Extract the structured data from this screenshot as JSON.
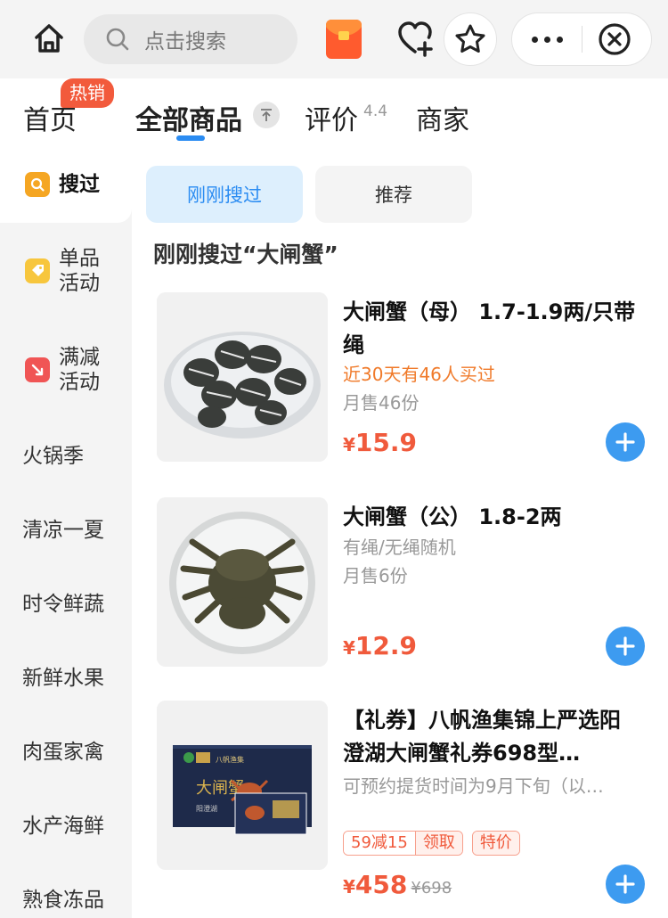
{
  "search": {
    "placeholder": "点击搜索"
  },
  "tabs": {
    "home": "首页",
    "hot_badge": "热销",
    "all": "全部商品",
    "review": "评价",
    "rating": "4.4",
    "shop": "商家"
  },
  "sidebar": {
    "items": [
      {
        "label": "搜过",
        "icon": "search-icon",
        "color": "#f5a623"
      },
      {
        "label": "单品活动",
        "line1": "单品",
        "line2": "活动",
        "icon": "tag-icon",
        "color": "#f7c63d"
      },
      {
        "label": "满减活动",
        "line1": "满减",
        "line2": "活动",
        "icon": "discount-icon",
        "color": "#f05555"
      },
      {
        "label": "火锅季"
      },
      {
        "label": "清凉一夏"
      },
      {
        "label": "时令鲜蔬"
      },
      {
        "label": "新鲜水果"
      },
      {
        "label": "肉蛋家禽"
      },
      {
        "label": "水产海鲜"
      },
      {
        "label": "熟食冻品"
      }
    ]
  },
  "segments": {
    "recent": "刚刚搜过",
    "recommend": "推荐"
  },
  "section_title": "刚刚搜过“大闸蟹”",
  "products": [
    {
      "name": "大闸蟹（母） 1.7-1.9两/只带绳",
      "highlight": "近30天有46人买过",
      "sales": "月售46份",
      "currency": "¥",
      "price": "15.9"
    },
    {
      "name": "大闸蟹（公） 1.8-2两",
      "desc": "有绳/无绳随机",
      "sales": "月售6份",
      "currency": "¥",
      "price": "12.9"
    },
    {
      "name": "【礼券】八帆渔集锦上严选阳澄湖大闸蟹礼券698型…",
      "desc": "可预约提货时间为9月下旬（以…",
      "tag_discount": "59减15",
      "tag_claim": "领取",
      "tag_special": "特价",
      "currency": "¥",
      "price": "458",
      "old_price": "¥698",
      "box_text": {
        "brand": "八帆渔集",
        "title": "大闸蟹",
        "lake": "阳澄湖"
      }
    }
  ],
  "colors": {
    "accent": "#2b8cf2",
    "price": "#f05a3c",
    "add_button": "#3d9bf0",
    "orange_text": "#f07a2a"
  }
}
